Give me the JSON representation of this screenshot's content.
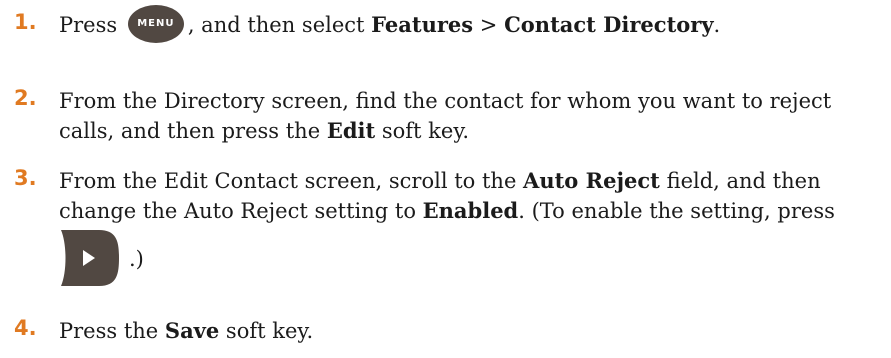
{
  "steps": [
    {
      "num": "1.",
      "parts": {
        "pre": "Press ",
        "key": "MENU",
        "mid": ", and then select ",
        "b1": "Features",
        "sep": " > ",
        "b2": "Contact Directory",
        "end": "."
      }
    },
    {
      "num": "2.",
      "parts": {
        "pre": "From the Directory screen, find the contact for whom you want to reject calls, and then press the ",
        "b1": "Edit",
        "end": " soft key."
      }
    },
    {
      "num": "3.",
      "parts": {
        "pre": "From the Edit Contact screen, scroll to the ",
        "b1": "Auto Reject",
        "mid": " field, and then change the Auto Reject setting to ",
        "b2": "Enabled",
        "end": ". (To enable the setting, press",
        "after": ".)"
      }
    },
    {
      "num": "4.",
      "parts": {
        "pre": "Press the ",
        "b1": "Save",
        "end": " soft key."
      }
    }
  ],
  "colors": {
    "step_number": "#e07a22",
    "key_fill": "#514842"
  },
  "icons": {
    "menu_key": "menu-key-icon",
    "right_arrow_key": "right-arrow-key-icon"
  }
}
